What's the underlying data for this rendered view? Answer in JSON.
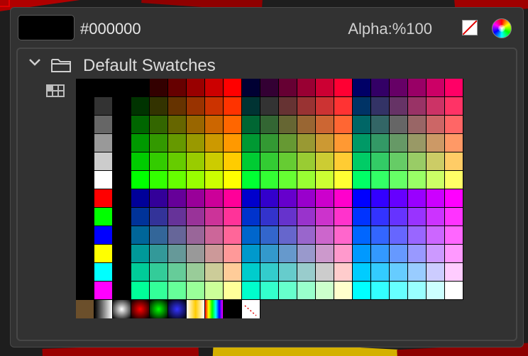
{
  "header": {
    "hex_value": "#000000",
    "alpha_label": "Alpha:%100"
  },
  "current_color": "#000000",
  "swatch_group": {
    "name": "Default Swatches"
  },
  "icons": {
    "collapse": "chevron-down-icon",
    "folder": "folder-icon",
    "grid_view": "grid-view-icon",
    "no_color": "no-color-icon",
    "color_picker": "color-wheel-icon"
  },
  "swatches": {
    "grays": [
      "#000000",
      "#333333",
      "#666666",
      "#999999",
      "#cccccc",
      "#ffffff"
    ],
    "primaries": [
      "#ff0000",
      "#00ff00",
      "#0000ff",
      "#ffff00",
      "#00ffff",
      "#ff00ff"
    ],
    "palette_levels": [
      "00",
      "33",
      "66",
      "99",
      "cc",
      "ff"
    ]
  },
  "gradients": [
    {
      "name": "brown-solid",
      "colors": [
        "#6b4f2b",
        "#6b4f2b"
      ],
      "kind": "solid"
    },
    {
      "name": "linear-gray",
      "colors": [
        "#000000",
        "#ffffff"
      ],
      "kind": "linear"
    },
    {
      "name": "radial-gray",
      "colors": [
        "#ffffff",
        "#000000"
      ],
      "kind": "radial"
    },
    {
      "name": "radial-red",
      "colors": [
        "#ff0000",
        "#000000"
      ],
      "kind": "radial"
    },
    {
      "name": "radial-green",
      "colors": [
        "#00ff00",
        "#000000"
      ],
      "kind": "radial"
    },
    {
      "name": "radial-blue",
      "colors": [
        "#3333ff",
        "#000000"
      ],
      "kind": "radial"
    },
    {
      "name": "linear-gold",
      "colors": [
        "#ffffff",
        "#ffcc00",
        "#ffffff"
      ],
      "kind": "linear"
    },
    {
      "name": "linear-rainbow",
      "colors": [
        "#ff0000",
        "#ffff00",
        "#00ff00",
        "#00ffff",
        "#0000ff",
        "#ff00ff"
      ],
      "kind": "linear"
    },
    {
      "name": "empty",
      "colors": [
        "#000000",
        "#000000"
      ],
      "kind": "solid"
    },
    {
      "name": "none",
      "colors": [
        "#ffffff",
        "#ffffff"
      ],
      "kind": "none"
    }
  ]
}
